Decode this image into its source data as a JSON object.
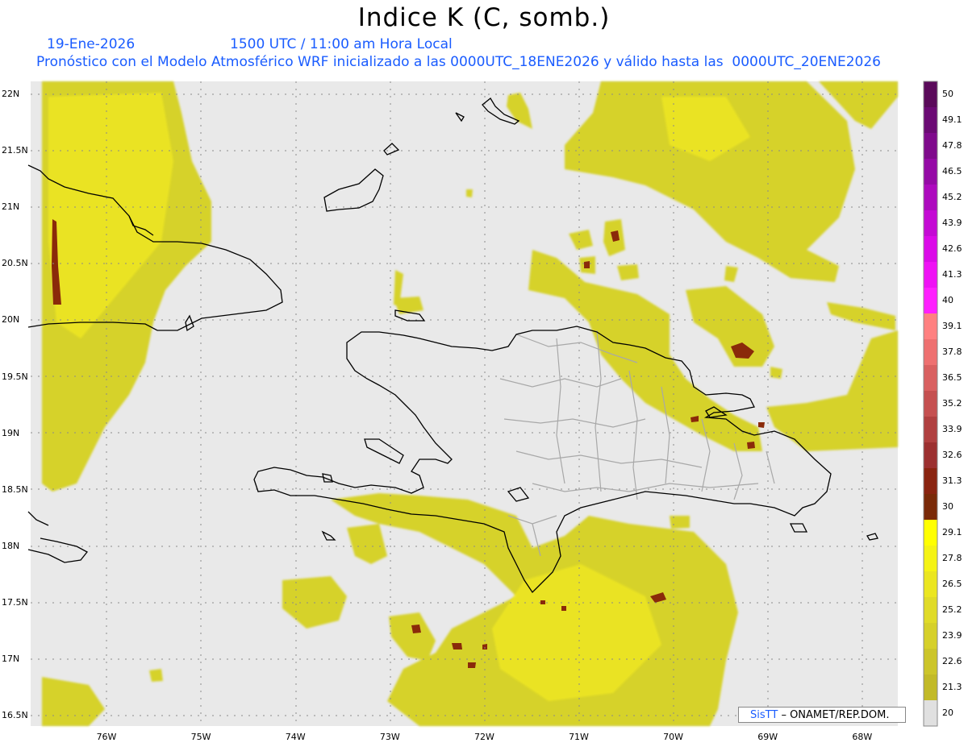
{
  "title": "Indice K (C, somb.)",
  "date_text": "19-Ene-2026",
  "time_text": "1500 UTC / 11:00 am Hora Local",
  "forecast_text": "Pronóstico con el Modelo Atmosférico WRF inicializado a las 0000UTC_18ENE2026 y válido hasta las  0000UTC_20ENE2026",
  "credit": {
    "logo": "SisTT",
    "text": "– ONAMET/REP.DOM."
  },
  "lat_labels": [
    "22N",
    "21.5N",
    "21N",
    "20.5N",
    "20N",
    "19.5N",
    "19N",
    "18.5N",
    "18N",
    "17.5N",
    "17N",
    "16.5N"
  ],
  "lon_labels": [
    "76W",
    "75W",
    "74W",
    "73W",
    "72W",
    "71W",
    "70W",
    "69W",
    "68W"
  ],
  "colorbar": {
    "labels": [
      "50",
      "49.1",
      "47.8",
      "46.5",
      "45.2",
      "43.9",
      "42.6",
      "41.3",
      "40",
      "39.1",
      "37.8",
      "36.5",
      "35.2",
      "33.9",
      "32.6",
      "31.3",
      "30",
      "29.1",
      "27.8",
      "26.5",
      "25.2",
      "23.9",
      "22.6",
      "21.3",
      "20"
    ],
    "colors": [
      "#5a0a5a",
      "#6b0a74",
      "#7f0a8c",
      "#950aa6",
      "#ad0abe",
      "#c40ad4",
      "#db0ae8",
      "#ef12f5",
      "#ff20ff",
      "#ff8080",
      "#ee7070",
      "#d96060",
      "#c55050",
      "#b04040",
      "#9c3030",
      "#8a2410",
      "#7a2a08",
      "#ffff00",
      "#f5f314",
      "#ebe620",
      "#e0db28",
      "#d6d02a",
      "#ccc52a",
      "#c2ba28",
      "#e0e0e0"
    ]
  },
  "colors": {
    "background": "#e9e9e9",
    "land_outline": "#000000",
    "provinces": "#a8a8a8",
    "yellow": "#d6d22a"
  }
}
